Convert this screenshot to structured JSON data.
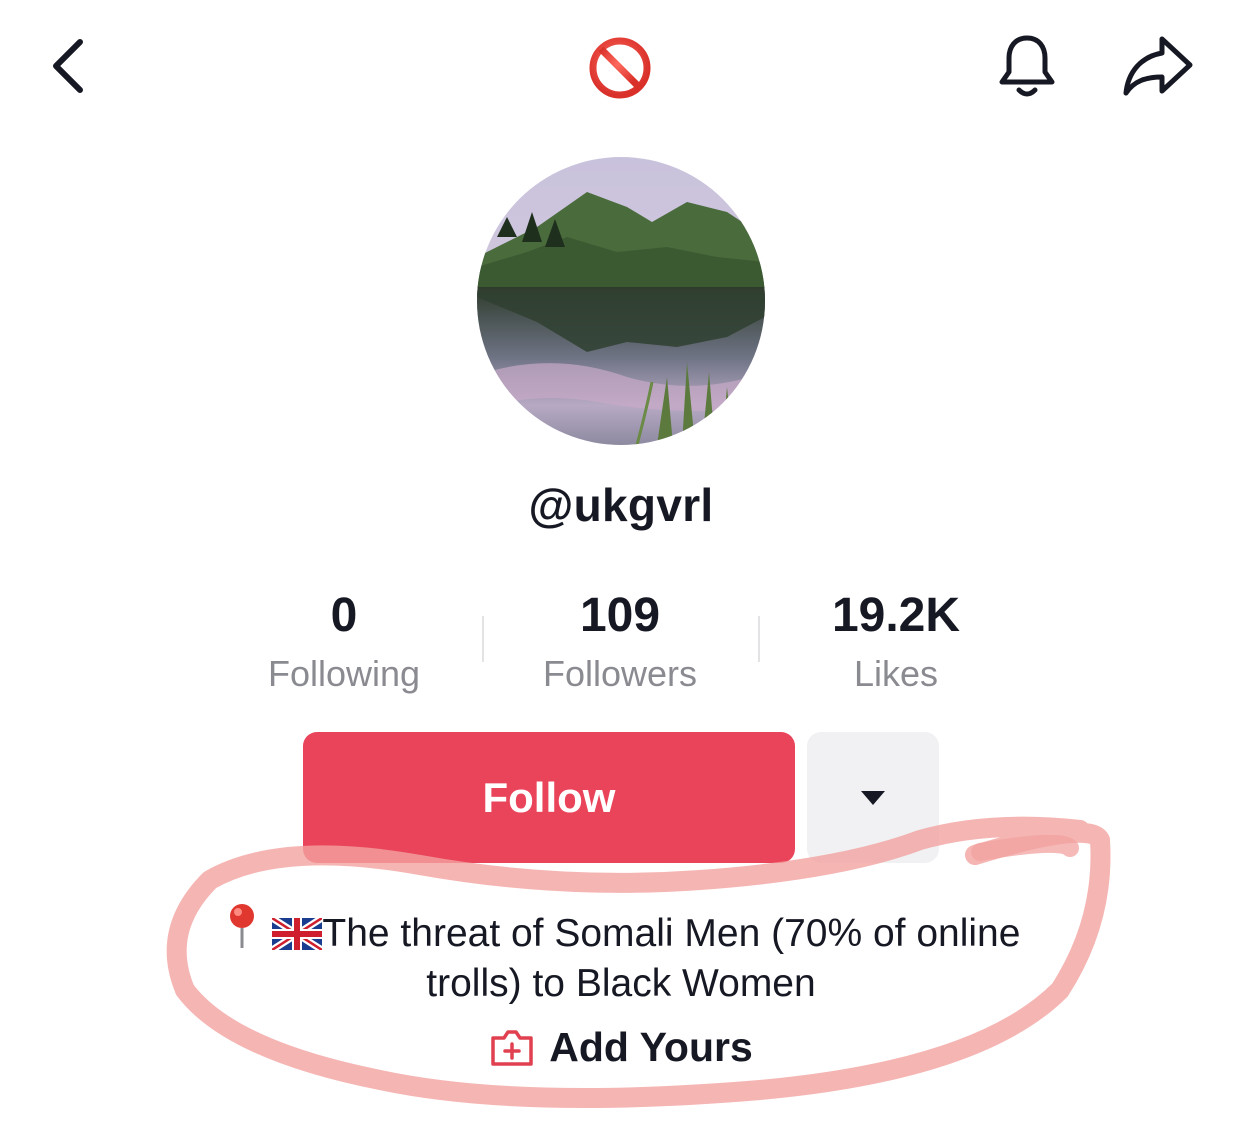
{
  "header": {
    "back_icon": "chevron-left-icon",
    "status_icon": "no-entry-icon",
    "bell_icon": "bell-icon",
    "share_icon": "share-arrow-icon"
  },
  "profile": {
    "username": "@ukgvrl",
    "avatar": "mountain-lake-reflection"
  },
  "stats": {
    "following": {
      "value": "0",
      "label": "Following"
    },
    "followers": {
      "value": "109",
      "label": "Followers"
    },
    "likes": {
      "value": "19.2K",
      "label": "Likes"
    }
  },
  "actions": {
    "follow_label": "Follow",
    "more_icon": "caret-down-icon"
  },
  "bio": {
    "line1": "The threat of Somali Men (70% of online",
    "line2": "trolls) to Black Women",
    "prefix_icons": [
      "round-pushpin-icon",
      "uk-flag-icon"
    ]
  },
  "add_yours": {
    "label": "Add Yours",
    "icon": "add-yours-icon"
  },
  "colors": {
    "accent": "#ea445a",
    "annotation": "#f0a0a0",
    "muted_text": "#8a8b91"
  }
}
